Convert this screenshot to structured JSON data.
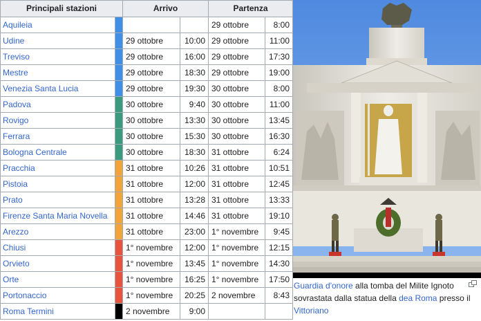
{
  "table": {
    "headers": {
      "stations": "Principali stazioni",
      "arrival": "Arrivo",
      "departure": "Partenza"
    },
    "rows": [
      {
        "station": "Aquileia",
        "segment": "blue",
        "arr_date": "",
        "arr_time": "",
        "dep_date": "29 ottobre",
        "dep_time": "8:00"
      },
      {
        "station": "Udine",
        "segment": "blue",
        "arr_date": "29 ottobre",
        "arr_time": "10:00",
        "dep_date": "29 ottobre",
        "dep_time": "11:00"
      },
      {
        "station": "Treviso",
        "segment": "blue",
        "arr_date": "29 ottobre",
        "arr_time": "16:00",
        "dep_date": "29 ottobre",
        "dep_time": "17:30"
      },
      {
        "station": "Mestre",
        "segment": "blue",
        "arr_date": "29 ottobre",
        "arr_time": "18:30",
        "dep_date": "29 ottobre",
        "dep_time": "19:00"
      },
      {
        "station": "Venezia Santa Lucia",
        "segment": "blue",
        "arr_date": "29 ottobre",
        "arr_time": "19:30",
        "dep_date": "30 ottobre",
        "dep_time": "8:00"
      },
      {
        "station": "Padova",
        "segment": "green",
        "arr_date": "30 ottobre",
        "arr_time": "9:40",
        "dep_date": "30 ottobre",
        "dep_time": "11:00"
      },
      {
        "station": "Rovigo",
        "segment": "green",
        "arr_date": "30 ottobre",
        "arr_time": "13:30",
        "dep_date": "30 ottobre",
        "dep_time": "13:45"
      },
      {
        "station": "Ferrara",
        "segment": "green",
        "arr_date": "30 ottobre",
        "arr_time": "15:30",
        "dep_date": "30 ottobre",
        "dep_time": "16:30"
      },
      {
        "station": "Bologna Centrale",
        "segment": "green",
        "arr_date": "30 ottobre",
        "arr_time": "18:30",
        "dep_date": "31 ottobre",
        "dep_time": "6:24"
      },
      {
        "station": "Pracchia",
        "segment": "orange",
        "arr_date": "31 ottobre",
        "arr_time": "10:26",
        "dep_date": "31 ottobre",
        "dep_time": "10:51"
      },
      {
        "station": "Pistoia",
        "segment": "orange",
        "arr_date": "31 ottobre",
        "arr_time": "12:00",
        "dep_date": "31 ottobre",
        "dep_time": "12:45"
      },
      {
        "station": "Prato",
        "segment": "orange",
        "arr_date": "31 ottobre",
        "arr_time": "13:28",
        "dep_date": "31 ottobre",
        "dep_time": "13:33"
      },
      {
        "station": "Firenze Santa Maria Novella",
        "segment": "orange",
        "arr_date": "31 ottobre",
        "arr_time": "14:46",
        "dep_date": "31 ottobre",
        "dep_time": "19:10"
      },
      {
        "station": "Arezzo",
        "segment": "orange",
        "arr_date": "31 ottobre",
        "arr_time": "23:00",
        "dep_date": "1° novembre",
        "dep_time": "9:45"
      },
      {
        "station": "Chiusi",
        "segment": "red",
        "arr_date": "1° novembre",
        "arr_time": "12:00",
        "dep_date": "1° novembre",
        "dep_time": "12:15"
      },
      {
        "station": "Orvieto",
        "segment": "red",
        "arr_date": "1° novembre",
        "arr_time": "13:45",
        "dep_date": "1° novembre",
        "dep_time": "14:30"
      },
      {
        "station": "Orte",
        "segment": "red",
        "arr_date": "1° novembre",
        "arr_time": "16:25",
        "dep_date": "1° novembre",
        "dep_time": "17:50"
      },
      {
        "station": "Portonaccio",
        "segment": "red",
        "arr_date": "1° novembre",
        "arr_time": "20:25",
        "dep_date": "2 novembre",
        "dep_time": "8:43"
      },
      {
        "station": "Roma Termini",
        "segment": "black",
        "arr_date": "2 novembre",
        "arr_time": "9:00",
        "dep_date": "",
        "dep_time": ""
      }
    ]
  },
  "segment_colors": {
    "blue": "#3f8fe8",
    "green": "#3a9a7e",
    "orange": "#f3a338",
    "red": "#e9533e",
    "black": "#000000"
  },
  "figure": {
    "image_subject": "monument-statue-with-honor-guard",
    "caption": {
      "link1": "Guardia d'onore",
      "text1": " alla tomba del Milite Ignoto sovrastata dalla statua della ",
      "link2": "dea Roma",
      "text2": " presso il ",
      "link3": "Vittoriano"
    }
  }
}
